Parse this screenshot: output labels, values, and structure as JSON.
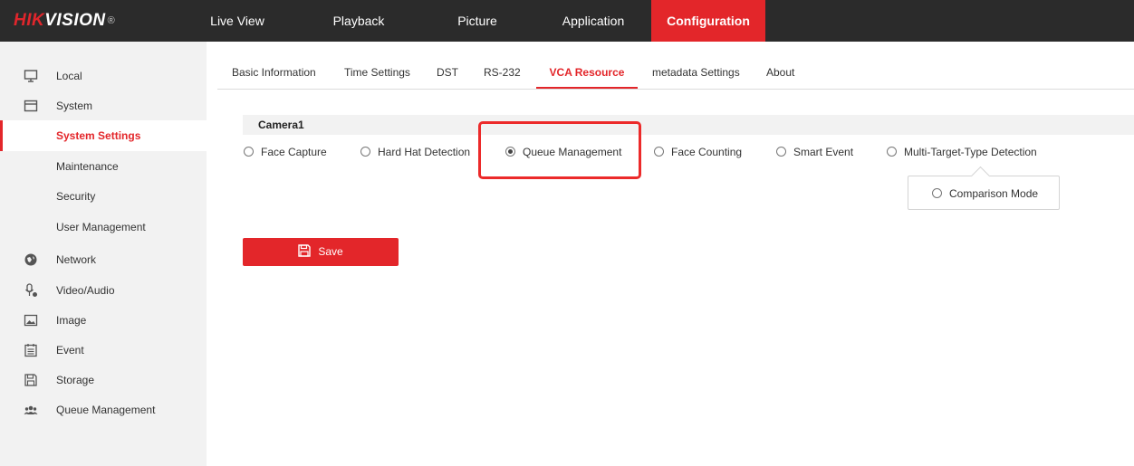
{
  "brand": {
    "hik": "HIK",
    "vision": "VISION",
    "reg": "®"
  },
  "nav": [
    {
      "label": "Live View"
    },
    {
      "label": "Playback"
    },
    {
      "label": "Picture"
    },
    {
      "label": "Application"
    },
    {
      "label": "Configuration",
      "active": true
    }
  ],
  "sidebar": {
    "items": [
      {
        "label": "Local",
        "icon": "monitor-icon"
      },
      {
        "label": "System",
        "icon": "system-icon"
      },
      {
        "label": "System Settings",
        "active": true
      },
      {
        "label": "Maintenance"
      },
      {
        "label": "Security"
      },
      {
        "label": "User Management"
      },
      {
        "label": "Network",
        "icon": "network-icon"
      },
      {
        "label": "Video/Audio",
        "icon": "microphone-icon"
      },
      {
        "label": "Image",
        "icon": "image-icon"
      },
      {
        "label": "Event",
        "icon": "calendar-icon"
      },
      {
        "label": "Storage",
        "icon": "storage-icon"
      },
      {
        "label": "Queue Management",
        "icon": "people-icon"
      }
    ]
  },
  "tabs": [
    {
      "label": "Basic Information"
    },
    {
      "label": "Time Settings"
    },
    {
      "label": "DST"
    },
    {
      "label": "RS-232"
    },
    {
      "label": "VCA Resource",
      "active": true
    },
    {
      "label": "metadata Settings"
    },
    {
      "label": "About"
    }
  ],
  "camera": {
    "title": "Camera1",
    "options": [
      {
        "label": "Face Capture",
        "checked": false
      },
      {
        "label": "Hard Hat Detection",
        "checked": false
      },
      {
        "label": "Queue Management",
        "checked": true
      },
      {
        "label": "Face Counting",
        "checked": false
      },
      {
        "label": "Smart Event",
        "checked": false
      },
      {
        "label": "Multi-Target-Type Detection",
        "checked": false
      }
    ],
    "sub_option": {
      "label": "Comparison Mode",
      "checked": false
    }
  },
  "save_label": "Save",
  "colors": {
    "accent": "#e3262a",
    "topbar": "#2b2b2b",
    "sidebar": "#f2f2f2"
  }
}
